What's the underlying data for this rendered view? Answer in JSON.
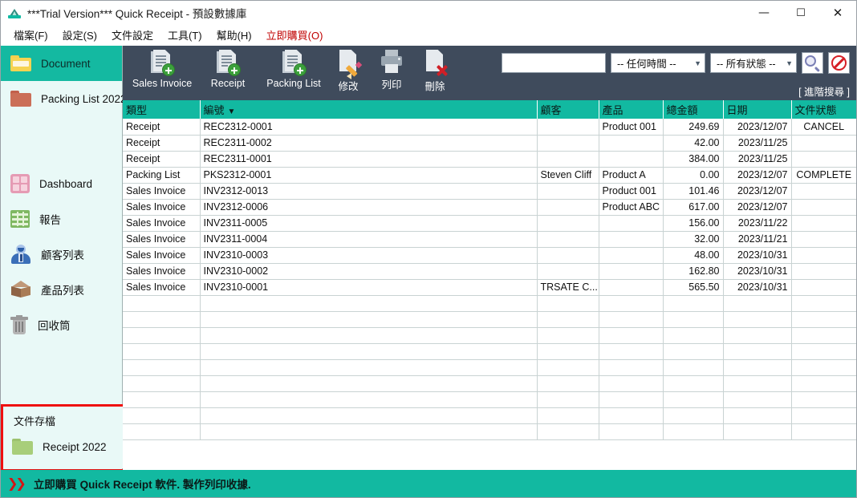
{
  "window": {
    "title": "***Trial Version*** Quick Receipt - 預設數據庫",
    "app_icon": "receipt-app-icon",
    "controls": {
      "minimize": "—",
      "maximize": "☐",
      "close": "✕"
    }
  },
  "menubar": {
    "items": [
      {
        "label": "檔案(F)",
        "accent": false
      },
      {
        "label": "設定(S)",
        "accent": false
      },
      {
        "label": "文件設定",
        "accent": false
      },
      {
        "label": "工具(T)",
        "accent": false
      },
      {
        "label": "幫助(H)",
        "accent": false
      },
      {
        "label": "立即購買(O)",
        "accent": true
      }
    ]
  },
  "sidebar": {
    "items": [
      {
        "label": "Document",
        "icon": "folder-yellow-icon",
        "selected": true
      },
      {
        "label": "Packing List 2022",
        "icon": "folder-red-icon",
        "selected": false
      },
      {
        "label": "Dashboard",
        "icon": "dashboard-grid-icon",
        "selected": false
      },
      {
        "label": "報告",
        "icon": "report-table-icon",
        "selected": false
      },
      {
        "label": "顧客列表",
        "icon": "customer-person-icon",
        "selected": false
      },
      {
        "label": "產品列表",
        "icon": "product-box-icon",
        "selected": false
      },
      {
        "label": "回收筒",
        "icon": "recycle-bin-icon",
        "selected": false
      }
    ],
    "archive": {
      "title": "文件存檔",
      "items": [
        {
          "label": "Receipt 2022",
          "icon": "folder-green-icon"
        }
      ]
    }
  },
  "toolbar": {
    "buttons": [
      {
        "label": "Sales Invoice",
        "icon": "document-add-icon"
      },
      {
        "label": "Receipt",
        "icon": "document-add-icon"
      },
      {
        "label": "Packing List",
        "icon": "document-add-icon"
      },
      {
        "label": "修改",
        "icon": "document-edit-icon"
      },
      {
        "label": "列印",
        "icon": "printer-icon"
      },
      {
        "label": "刪除",
        "icon": "document-delete-icon"
      }
    ]
  },
  "search": {
    "keyword_value": "",
    "keyword_placeholder": "",
    "time_filter": "-- 任何時間 --",
    "status_filter": "-- 所有狀態 --",
    "search_icon": "magnifier-icon",
    "clear_icon": "no-entry-icon",
    "advanced_label": "[ 進階搜尋 ]"
  },
  "table": {
    "columns": [
      {
        "key": "type",
        "label": "類型"
      },
      {
        "key": "no",
        "label": "編號",
        "sorted": true,
        "sort_arrow": "▼"
      },
      {
        "key": "customer",
        "label": "顧客"
      },
      {
        "key": "product",
        "label": "產品"
      },
      {
        "key": "amount",
        "label": "總金額"
      },
      {
        "key": "date",
        "label": "日期"
      },
      {
        "key": "status",
        "label": "文件狀態"
      }
    ],
    "rows": [
      {
        "type": "Receipt",
        "no": "REC2312-0001",
        "customer": "",
        "product": "Product 001",
        "amount": "249.69",
        "date": "2023/12/07",
        "status": "CANCEL"
      },
      {
        "type": "Receipt",
        "no": "REC2311-0002",
        "customer": "",
        "product": "",
        "amount": "42.00",
        "date": "2023/11/25",
        "status": ""
      },
      {
        "type": "Receipt",
        "no": "REC2311-0001",
        "customer": "",
        "product": "",
        "amount": "384.00",
        "date": "2023/11/25",
        "status": ""
      },
      {
        "type": "Packing List",
        "no": "PKS2312-0001",
        "customer": "Steven Cliff",
        "product": "Product A",
        "amount": "0.00",
        "date": "2023/12/07",
        "status": "COMPLETE"
      },
      {
        "type": "Sales Invoice",
        "no": "INV2312-0013",
        "customer": "",
        "product": "Product 001",
        "amount": "101.46",
        "date": "2023/12/07",
        "status": ""
      },
      {
        "type": "Sales Invoice",
        "no": "INV2312-0006",
        "customer": "",
        "product": "Product ABC",
        "amount": "617.00",
        "date": "2023/12/07",
        "status": ""
      },
      {
        "type": "Sales Invoice",
        "no": "INV2311-0005",
        "customer": "",
        "product": "",
        "amount": "156.00",
        "date": "2023/11/22",
        "status": ""
      },
      {
        "type": "Sales Invoice",
        "no": "INV2311-0004",
        "customer": "",
        "product": "",
        "amount": "32.00",
        "date": "2023/11/21",
        "status": ""
      },
      {
        "type": "Sales Invoice",
        "no": "INV2310-0003",
        "customer": "",
        "product": "",
        "amount": "48.00",
        "date": "2023/10/31",
        "status": ""
      },
      {
        "type": "Sales Invoice",
        "no": "INV2310-0002",
        "customer": "",
        "product": "",
        "amount": "162.80",
        "date": "2023/10/31",
        "status": ""
      },
      {
        "type": "Sales Invoice",
        "no": "INV2310-0001",
        "customer": "TRSATE C...",
        "product": "",
        "amount": "565.50",
        "date": "2023/10/31",
        "status": ""
      }
    ]
  },
  "statusbar": {
    "chevron": "❯",
    "text": "立即購買 Quick Receipt 軟件. 製作列印收據."
  },
  "colors": {
    "teal": "#12b9a1",
    "toolbar_dark": "#3f4b5c",
    "sidebar_bg": "#e9f9f7",
    "accent_red": "#c00000",
    "annotation_red": "#ef1010"
  }
}
